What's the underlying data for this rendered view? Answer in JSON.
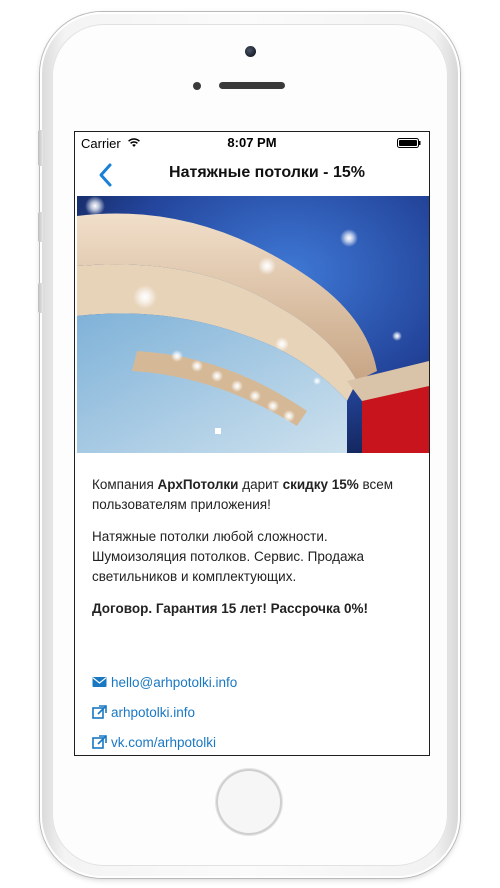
{
  "status_bar": {
    "carrier": "Carrier",
    "time": "8:07 PM"
  },
  "nav": {
    "title": "Натяжные потолки - 15%",
    "back_icon": "chevron-left-icon"
  },
  "hero_image": {
    "subject": "stretch-ceiling-photo"
  },
  "content": {
    "para1_prefix": "Компания ",
    "para1_company": "АрхПотолки",
    "para1_middle": " дарит ",
    "para1_discount": "скидку 15%",
    "para1_suffix": " всем пользователям приложения!",
    "para2": "Натяжные потолки любой сложности. Шумоизоляция потолков. Сервис. Продажа светильников и комплектующих.",
    "para3": "Договор. Гарантия 15 лет! Рассрочка 0%!"
  },
  "links": [
    {
      "icon": "envelope-icon",
      "text": "hello@arhpotolki.info"
    },
    {
      "icon": "external-link-icon",
      "text": "arhpotolki.info"
    },
    {
      "icon": "external-link-icon",
      "text": "vk.com/arhpotolki"
    }
  ],
  "colors": {
    "accent": "#1a78c2",
    "nav_back": "#1a7fd6"
  }
}
